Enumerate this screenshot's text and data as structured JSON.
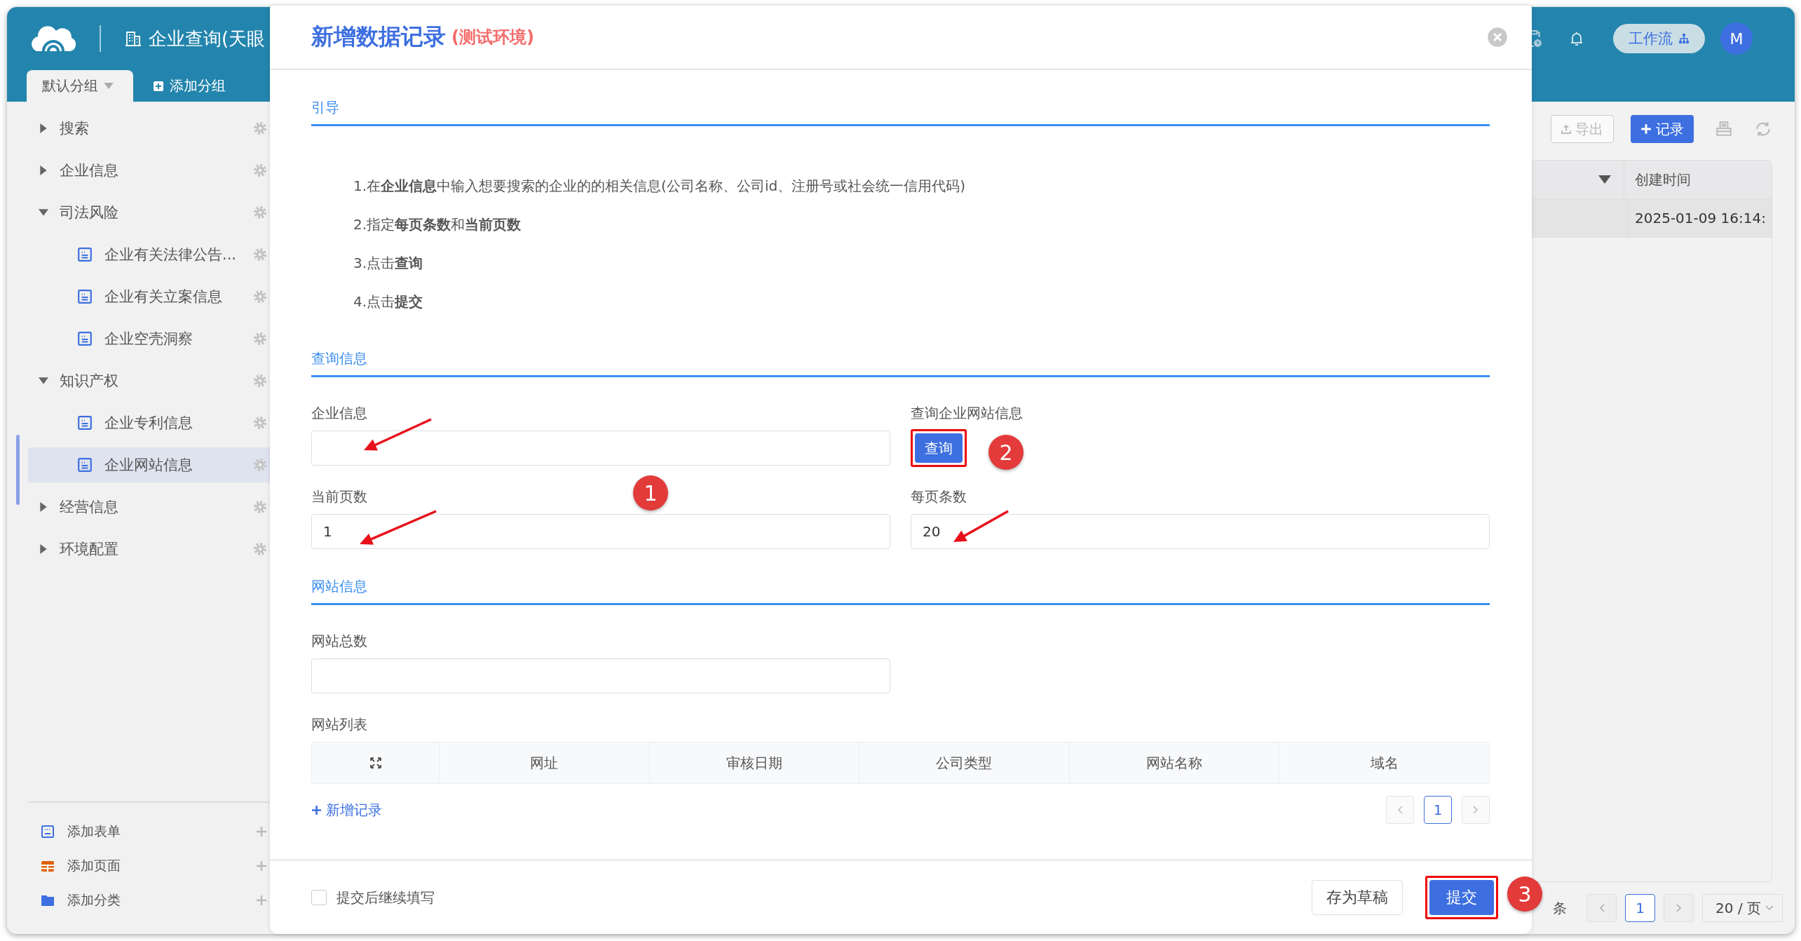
{
  "app": {
    "title": "企业查询(天眼",
    "group_tabs": [
      {
        "label": "默认分组",
        "selected": true,
        "kind": "dropdown"
      },
      {
        "label": "添加分组",
        "selected": false,
        "kind": "add"
      }
    ],
    "workflow_button": "工作流",
    "avatar": "M"
  },
  "sidebar": {
    "items": [
      {
        "label": "搜索",
        "expanded": false
      },
      {
        "label": "企业信息",
        "expanded": false
      },
      {
        "label": "司法风险",
        "expanded": true,
        "children": [
          {
            "label": "企业有关法律公告...",
            "selected": false
          },
          {
            "label": "企业有关立案信息",
            "selected": false
          },
          {
            "label": "企业空壳洞察",
            "selected": false
          }
        ]
      },
      {
        "label": "知识产权",
        "expanded": true,
        "children": [
          {
            "label": "企业专利信息",
            "selected": false
          },
          {
            "label": "企业网站信息",
            "selected": true
          }
        ]
      },
      {
        "label": "经营信息",
        "expanded": false
      },
      {
        "label": "环境配置",
        "expanded": false
      }
    ],
    "footer_actions": [
      {
        "label": "添加表单",
        "kind": "form"
      },
      {
        "label": "添加页面",
        "kind": "page"
      },
      {
        "label": "添加分类",
        "kind": "category"
      }
    ]
  },
  "records": {
    "toolbar": [
      {
        "label": "导出",
        "kind": "export"
      },
      {
        "label": "记录",
        "kind": "add"
      }
    ],
    "columns": [
      "创建时间"
    ],
    "rows": [
      [
        "2025-01-09 16:14:"
      ]
    ],
    "total_suffix": "条",
    "pages": [
      {
        "label": "1",
        "selected": true
      }
    ],
    "page_size": "20 / 页"
  },
  "dialog": {
    "title": "新增数据记录",
    "env_tag": "(测试环境)",
    "sections": [
      {
        "title": "引导",
        "kind": "guide",
        "lines": [
          "1.在**企业信息**中输入想要搜索的企业的的相关信息(公司名称、公司id、注册号或社会统一信用代码)",
          "2.指定**每页条数**和**当前页数**",
          "3.点击**查询**",
          "4.点击**提交**"
        ]
      },
      {
        "title": "查询信息",
        "kind": "fields",
        "fields": [
          {
            "label": "企业信息",
            "kind": "input"
          },
          {
            "label": "查询企业网站信息",
            "kind": "button",
            "button": "查询",
            "highlighted": true
          },
          {
            "label": "当前页数",
            "kind": "input",
            "value": "1"
          },
          {
            "label": "每页条数",
            "kind": "input",
            "value": "20"
          }
        ]
      },
      {
        "title": "网站信息",
        "kind": "fields",
        "fields": [
          {
            "label": "网站总数",
            "kind": "input"
          },
          {
            "label": "网站列表",
            "kind": "table",
            "columns": [
              "网址",
              "审核日期",
              "公司类型",
              "网站名称",
              "域名"
            ],
            "add_label": "新增记录",
            "pages": [
              {
                "label": "1",
                "selected": true
              }
            ]
          }
        ]
      }
    ],
    "continue_checkbox": {
      "label": "提交后继续填写",
      "checked": false
    },
    "buttons": [
      {
        "label": "存为草稿",
        "kind": "default",
        "highlighted": false
      },
      {
        "label": "提交",
        "kind": "primary",
        "highlighted": true
      }
    ]
  },
  "annotations": [
    {
      "label": "1"
    },
    {
      "label": "2"
    },
    {
      "label": "3"
    }
  ]
}
